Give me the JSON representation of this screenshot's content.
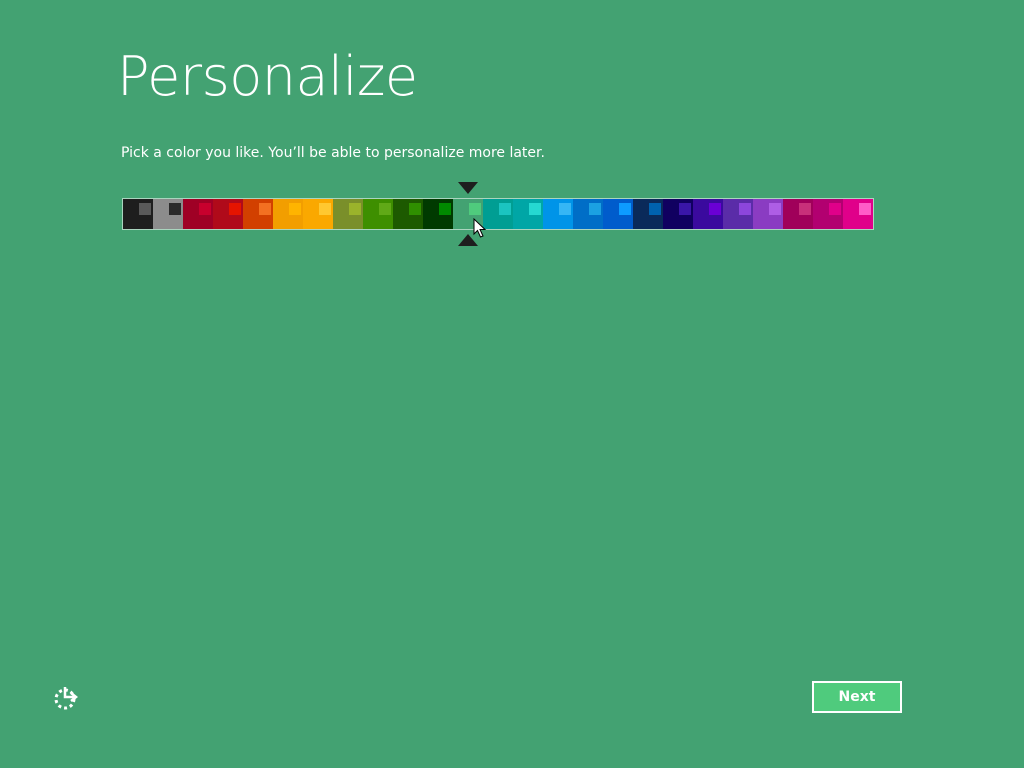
{
  "page": {
    "title": "Personalize",
    "subtitle": "Pick a color you like. You’ll be able to personalize more later."
  },
  "colors": {
    "background": "#43A272",
    "button_fill": "#4FCB7D"
  },
  "palette": {
    "selected_index": 11,
    "swatches": [
      {
        "base": "#1E1E1E",
        "accent": "#5A5A5A"
      },
      {
        "base": "#8C8C8C",
        "accent": "#2A2A2A"
      },
      {
        "base": "#9F0025",
        "accent": "#C8002D"
      },
      {
        "base": "#B00A1A",
        "accent": "#E51400"
      },
      {
        "base": "#D24000",
        "accent": "#F37021"
      },
      {
        "base": "#F29E00",
        "accent": "#FFB400"
      },
      {
        "base": "#FAA800",
        "accent": "#FFC830"
      },
      {
        "base": "#7A8F2A",
        "accent": "#9AB32B"
      },
      {
        "base": "#3E8F00",
        "accent": "#60A917"
      },
      {
        "base": "#1D5A00",
        "accent": "#2F8F00"
      },
      {
        "base": "#003A00",
        "accent": "#008A00"
      },
      {
        "base": "#43A272",
        "accent": "#4FCB7D"
      },
      {
        "base": "#009E93",
        "accent": "#1BC4C0"
      },
      {
        "base": "#00A6A6",
        "accent": "#25D8D1"
      },
      {
        "base": "#0094E8",
        "accent": "#35B6F5"
      },
      {
        "base": "#006EC7",
        "accent": "#1BA1E2"
      },
      {
        "base": "#005CCC",
        "accent": "#0D9BFF"
      },
      {
        "base": "#0A2A5A",
        "accent": "#0062AF"
      },
      {
        "base": "#100060",
        "accent": "#3A16A8"
      },
      {
        "base": "#3A0A9E",
        "accent": "#6A00D5"
      },
      {
        "base": "#5A2CA8",
        "accent": "#8C46DC"
      },
      {
        "base": "#8A3CC2",
        "accent": "#AE5EE5"
      },
      {
        "base": "#A0005A",
        "accent": "#C8307A"
      },
      {
        "base": "#B20070",
        "accent": "#E0008A"
      },
      {
        "base": "#E0008A",
        "accent": "#FF5CC8"
      }
    ]
  },
  "buttons": {
    "next": "Next"
  },
  "icons": {
    "ease_of_access": "ease-of-access-icon"
  }
}
